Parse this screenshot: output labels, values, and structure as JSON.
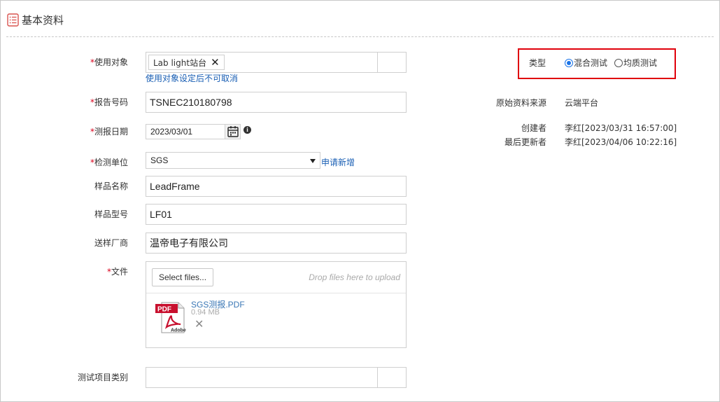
{
  "section": {
    "title": "基本资料",
    "icon": "list-icon"
  },
  "form": {
    "target": {
      "required_mark": "*",
      "label": "使用对象",
      "tag": "Lab light站台",
      "tag_close": "✕",
      "hint": "使用对象设定后不可取消"
    },
    "report_no": {
      "required_mark": "*",
      "label": "报告号码",
      "value": "TSNEC210180798"
    },
    "test_date": {
      "required_mark": "*",
      "label": "测报日期",
      "value": "2023/03/01",
      "icon": "calendar-icon",
      "info_icon": "info-icon"
    },
    "test_unit": {
      "required_mark": "*",
      "label": "检测单位",
      "value": "SGS",
      "apply_link": "申请新增"
    },
    "sample_name": {
      "label": "样品名称",
      "value": "LeadFrame"
    },
    "sample_model": {
      "label": "样品型号",
      "value": "LF01"
    },
    "vendor": {
      "label": "送样厂商",
      "value": "温帝电子有限公司"
    },
    "files": {
      "required_mark": "*",
      "label": "文件",
      "select_button": "Select files...",
      "drop_hint": "Drop files here to upload",
      "items": [
        {
          "name": "SGS测报.PDF",
          "size": "0.94 MB",
          "icon": "pdf-file-icon",
          "remove": "✕"
        }
      ]
    },
    "test_item_category": {
      "label": "测试项目类别",
      "value": ""
    }
  },
  "type": {
    "label": "类型",
    "options": [
      {
        "label": "混合测试",
        "selected": true
      },
      {
        "label": "均质测试",
        "selected": false
      }
    ]
  },
  "meta": {
    "source": {
      "label": "原始资料来源",
      "value": "云端平台"
    },
    "creator": {
      "label": "创建者",
      "value": "李红[2023/03/31 16:57:00]"
    },
    "updater": {
      "label": "最后更新者",
      "value": "李红[2023/04/06 10:22:16]"
    }
  },
  "colors": {
    "required": "#d9001b",
    "link": "#1a5fb4",
    "highlight_border": "#e0000b",
    "radio": "#1a73e8"
  }
}
